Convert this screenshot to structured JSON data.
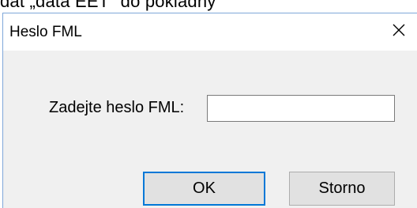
{
  "background": {
    "partial_text": "dat „data EET\" do pokladny"
  },
  "dialog": {
    "title": "Heslo FML",
    "close_icon": "close-icon",
    "field_label": "Zadejte heslo FML:",
    "password_value": "",
    "ok_label": "OK",
    "cancel_label": "Storno"
  },
  "colors": {
    "dialog_border": "#7fa7d9",
    "content_bg": "#f0f0f0",
    "button_bg": "#e1e1e1",
    "default_button_border": "#0078d7"
  }
}
